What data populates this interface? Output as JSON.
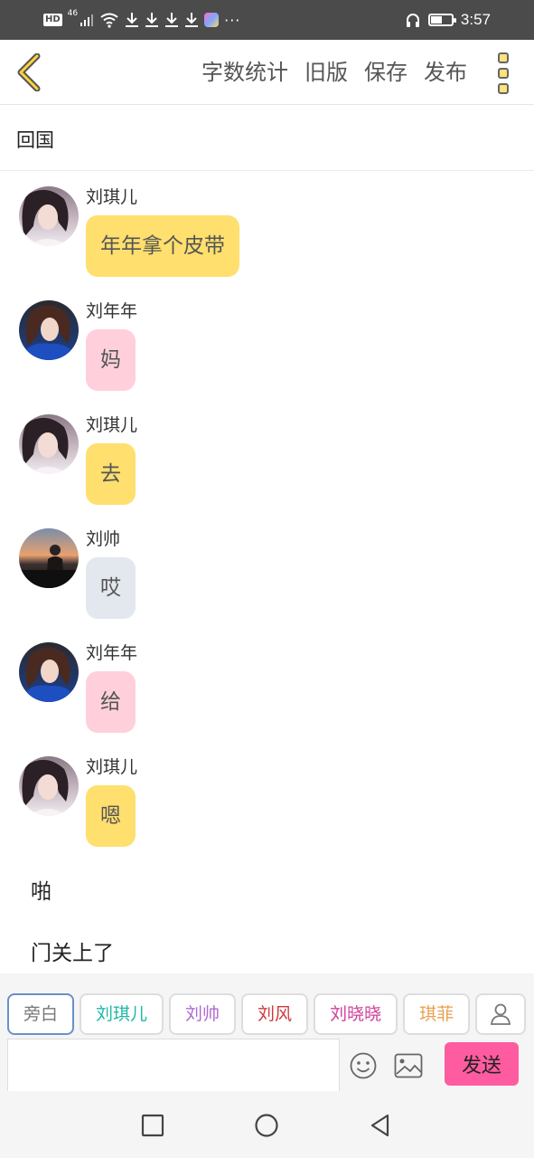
{
  "status_bar": {
    "network_badge": "HD",
    "network_type": "46",
    "time": "3:57",
    "battery_level": 0.55
  },
  "nav": {
    "actions": [
      "字数统计",
      "旧版",
      "保存",
      "发布"
    ]
  },
  "story": {
    "title": "回国"
  },
  "messages": [
    {
      "sender": "刘琪儿",
      "text": "年年拿个皮带",
      "avatar": "avatar-liuqier",
      "bubble_color": "#ffdf6e"
    },
    {
      "sender": "刘年年",
      "text": "妈",
      "avatar": "avatar-liunian",
      "bubble_color": "#ffd0dc"
    },
    {
      "sender": "刘琪儿",
      "text": "去",
      "avatar": "avatar-liuqier",
      "bubble_color": "#ffdf6e"
    },
    {
      "sender": "刘帅",
      "text": "哎",
      "avatar": "avatar-liushuai",
      "bubble_color": "#e3e7ee"
    },
    {
      "sender": "刘年年",
      "text": "给",
      "avatar": "avatar-liunian",
      "bubble_color": "#ffd0dc"
    },
    {
      "sender": "刘琪儿",
      "text": "嗯",
      "avatar": "avatar-liuqier",
      "bubble_color": "#ffdf6e"
    }
  ],
  "narration": [
    "啪",
    "门关上了"
  ],
  "compose": {
    "characters": [
      {
        "name": "旁白",
        "color": "#777777",
        "selected": true
      },
      {
        "name": "刘琪儿",
        "color": "#1fb8a8",
        "selected": false
      },
      {
        "name": "刘帅",
        "color": "#b06ad0",
        "selected": false
      },
      {
        "name": "刘风",
        "color": "#cc3a3a",
        "selected": false
      },
      {
        "name": "刘晓晓",
        "color": "#d0409a",
        "selected": false
      },
      {
        "name": "琪菲",
        "color": "#e8a050",
        "selected": false
      }
    ],
    "input_value": "",
    "send_label": "发送"
  },
  "colors": {
    "accent_yellow": "#ffdf6e",
    "accent_pink": "#ff5ba0"
  }
}
